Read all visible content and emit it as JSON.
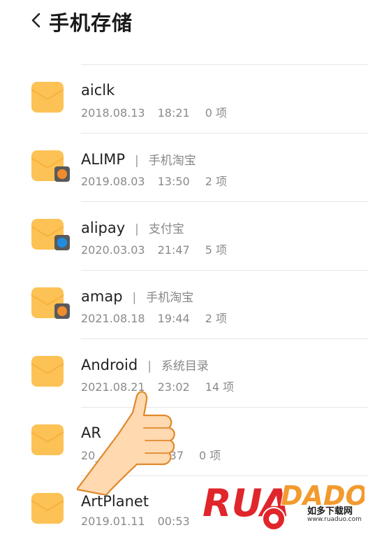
{
  "header": {
    "back_icon": "chevron-left-icon",
    "title": "手机存储"
  },
  "colors": {
    "folder": "#FDC255",
    "folder_dark": "#F7B23E",
    "accent_red": "#E0252B",
    "accent_orange": "#F29A2E"
  },
  "files": [
    {
      "name": "aiclk",
      "source": "",
      "date": "2018.08.13",
      "time": "18:21",
      "count": "0 项",
      "badge": ""
    },
    {
      "name": "ALIMP",
      "source": "手机淘宝",
      "date": "2019.08.03",
      "time": "13:50",
      "count": "2 项",
      "badge": "taobao-app-icon"
    },
    {
      "name": "alipay",
      "source": "支付宝",
      "date": "2020.03.03",
      "time": "21:47",
      "count": "5 项",
      "badge": "alipay-app-icon"
    },
    {
      "name": "amap",
      "source": "手机淘宝",
      "date": "2021.08.18",
      "time": "19:44",
      "count": "2 项",
      "badge": "taobao-app-icon"
    },
    {
      "name": "Android",
      "source": "系统目录",
      "date": "2021.08.21",
      "time": "23:02",
      "count": "14 项",
      "badge": ""
    },
    {
      "name": "AR",
      "source": "",
      "date": "20__.__.07",
      "time": "17:37",
      "count": "0 项",
      "badge": ""
    },
    {
      "name": "ArtPlanet",
      "source": "",
      "date": "2019.01.11",
      "time": "00:53",
      "count": "",
      "badge": ""
    }
  ],
  "watermark": {
    "brand": "RUADADO",
    "sub": "如多下载网",
    "url": "www.ruaduo.com"
  }
}
